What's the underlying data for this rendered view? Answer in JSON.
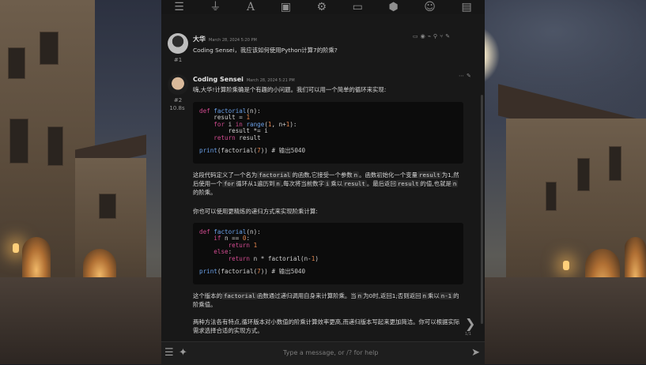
{
  "toolbar": {
    "icons": [
      "sliders-icon",
      "plug-icon",
      "font-icon",
      "book-icon",
      "user-gear-icon",
      "image-icon",
      "cubes-icon",
      "face-smile-icon",
      "id-card-icon"
    ]
  },
  "messages": [
    {
      "author": "大华",
      "timestamp": "March 28, 2024 5:20 PM",
      "index": "#1",
      "text": "Coding Sensei，我应该如何使用Python计算7的阶乘?"
    },
    {
      "author": "Coding Sensei",
      "timestamp": "March 28, 2024 5:21 PM",
      "index": "#2",
      "elapsed": "10.8s",
      "intro": "嗨,大华!计算阶乘确是个有趣的小问题。我们可以用一个简单的循环来实现:",
      "code1": [
        "def factorial(n):",
        "    result = 1",
        "    for i in range(1, n+1):",
        "        result *= i",
        "    return result",
        "",
        "print(factorial(7)) # 输出5040"
      ],
      "explain1": {
        "p1": "这段代码定义了一个名为",
        "c1": "factorial",
        "p2": "的函数,它接受一个参数",
        "c2": "n",
        "p3": "。函数初始化一个变量",
        "c3": "result",
        "p4": "为1,然后使用一个",
        "c4": "for",
        "p5": "循环从1遍历到",
        "c5": "n",
        "p6": ",每次将当前数字",
        "c6": "i",
        "p7": "乘以",
        "c7": "result",
        "p8": "。最后返回",
        "c8": "result",
        "p9": "的值,也就是",
        "c9": "n",
        "p10": "的阶乘。"
      },
      "middle": "你也可以使用更精炼的递归方式来实现阶乘计算:",
      "code2": [
        "def factorial(n):",
        "    if n == 0:",
        "        return 1",
        "    else:",
        "        return n * factorial(n-1)",
        "",
        "print(factorial(7)) # 输出5040"
      ],
      "explain2": {
        "p1": "这个版本的",
        "c1": "factorial",
        "p2": "函数通过递归调用自身来计算阶乘。当",
        "c2": "n",
        "p3": "为0时,返回1;否则返回",
        "c3": "n",
        "p4": "乘以",
        "c4": "n-1",
        "p5": "的阶乘值。"
      },
      "final": "两种方法各有特点,循环版本对小数值的阶乘计算效率更高,而递归版本写起来更加简洁。你可以根据实际需求选择合适的实现方式。"
    }
  ],
  "swipe": {
    "counter": "1/1"
  },
  "input": {
    "placeholder": "Type a message, or /? for help"
  }
}
